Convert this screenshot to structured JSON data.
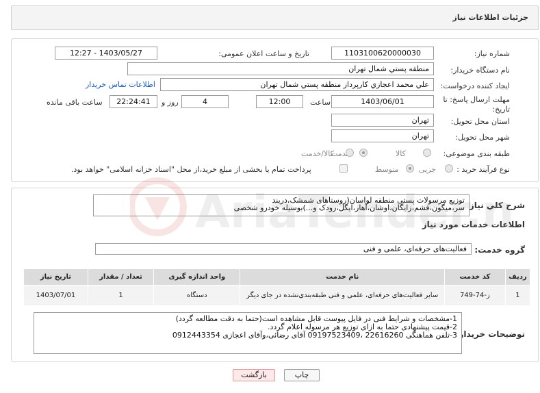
{
  "header": {
    "title": "جزئیات اطلاعات نیاز"
  },
  "form": {
    "need_number_label": "شماره نیاز:",
    "need_number": "1103100620000030",
    "announce_label": "تاریخ و ساعت اعلان عمومی:",
    "announce_value": "1403/05/27 - 12:27",
    "buyer_org_label": "نام دستگاه خریدار:",
    "buyer_org": "منطقه پستي شمال تهران",
    "creator_label": "ایجاد کننده درخواست:",
    "creator": "علي محمد اعجازي کارپرداز منطقه پستي شمال تهران",
    "contact_link": "اطلاعات تماس خریدار",
    "deadline_label": "مهلت ارسال پاسخ: تا تاریخ:",
    "deadline_date": "1403/06/01",
    "time_label": "ساعت",
    "deadline_time": "12:00",
    "days_value": "4",
    "days_label": "روز و",
    "remaining_time": "22:24:41",
    "remaining_label": "ساعت باقی مانده",
    "province_label": "استان محل تحویل:",
    "province": "تهران",
    "city_label": "شهر محل تحویل:",
    "city": "تهران",
    "category_label": "طبقه بندی موضوعی:",
    "category_options": [
      "کالا",
      "خدمت",
      "کالا/خدمت"
    ],
    "category_selected": "خدمت",
    "process_label": "نوع فرآیند خرید :",
    "process_options": [
      "جزیی",
      "متوسط"
    ],
    "process_selected": "متوسط",
    "payment_note": "پرداخت تمام یا بخشی از مبلغ خرید،از محل \"اسناد خزانه اسلامی\" خواهد بود."
  },
  "summary": {
    "label": "شرح کلي نیاز:",
    "text": "توزیع مرسولات پستی منطقه لواسان(روستاهای شمشک،دربند\nسر،میگون،فشم،زایگان،اوشان،آهار،ایگل،رودک و...)بوسیله خودرو شخصی"
  },
  "services": {
    "section_title": "اطلاعات خدمات مورد نیاز",
    "group_label": "گروه خدمت:",
    "group_value": "فعالیت‌های حرفه‌ای، علمی و فنی",
    "columns": [
      "ردیف",
      "کد خدمت",
      "نام خدمت",
      "واحد اندازه گیری",
      "تعداد / مقدار",
      "تاریخ نیاز"
    ],
    "rows": [
      {
        "row": "1",
        "code": "ز-74-749",
        "name": "سایر فعالیت‌های حرفه‌ای، علمی و فنی طبقه‌بندی‌نشده در جای دیگر",
        "unit": "دستگاه",
        "qty": "1",
        "date": "1403/07/01"
      }
    ]
  },
  "buyer_notes": {
    "label": "توضیحات خریدار:",
    "text": "1-مشخصات و شرایط فنی در فایل پیوست قابل مشاهده است(حتما به دقت مطالعه گردد)\n2-قیمت پیشنهادی حتما به ازای توزیع هر مرسوله اعلام گردد.\n3-تلفن هماهنگی 22616260 ،09197523409 آقای رضائی،وآقای اعجازی 0912443354"
  },
  "buttons": {
    "print": "چاپ",
    "back": "بازگشت"
  },
  "watermark": {
    "text": "AriaTender.neT"
  }
}
